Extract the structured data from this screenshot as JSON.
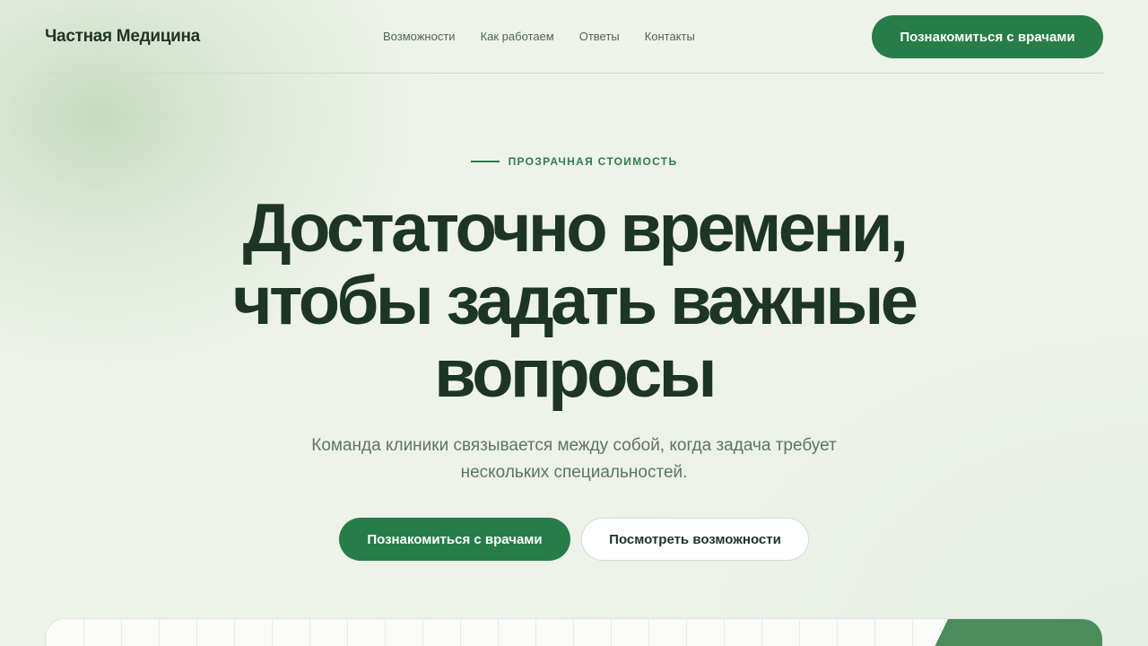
{
  "header": {
    "logo": "Частная Медицина",
    "nav": [
      "Возможности",
      "Как работаем",
      "Ответы",
      "Контакты"
    ],
    "cta_label": "Познакомиться с врачами"
  },
  "hero": {
    "eyebrow": "ПРОЗРАЧНАЯ СТОИМОСТЬ",
    "title_lines": [
      "Достаточно времени,",
      "чтобы задать важные",
      "вопросы"
    ],
    "subtitle": "Команда клиники связывается между собой, когда задача требует нескольких специальностей.",
    "primary_label": "Познакомиться с врачами",
    "secondary_label": "Посмотреть возможности"
  },
  "colors": {
    "accent": "#267d47",
    "background": "#eef3ea",
    "text_dark": "#1c3526"
  }
}
